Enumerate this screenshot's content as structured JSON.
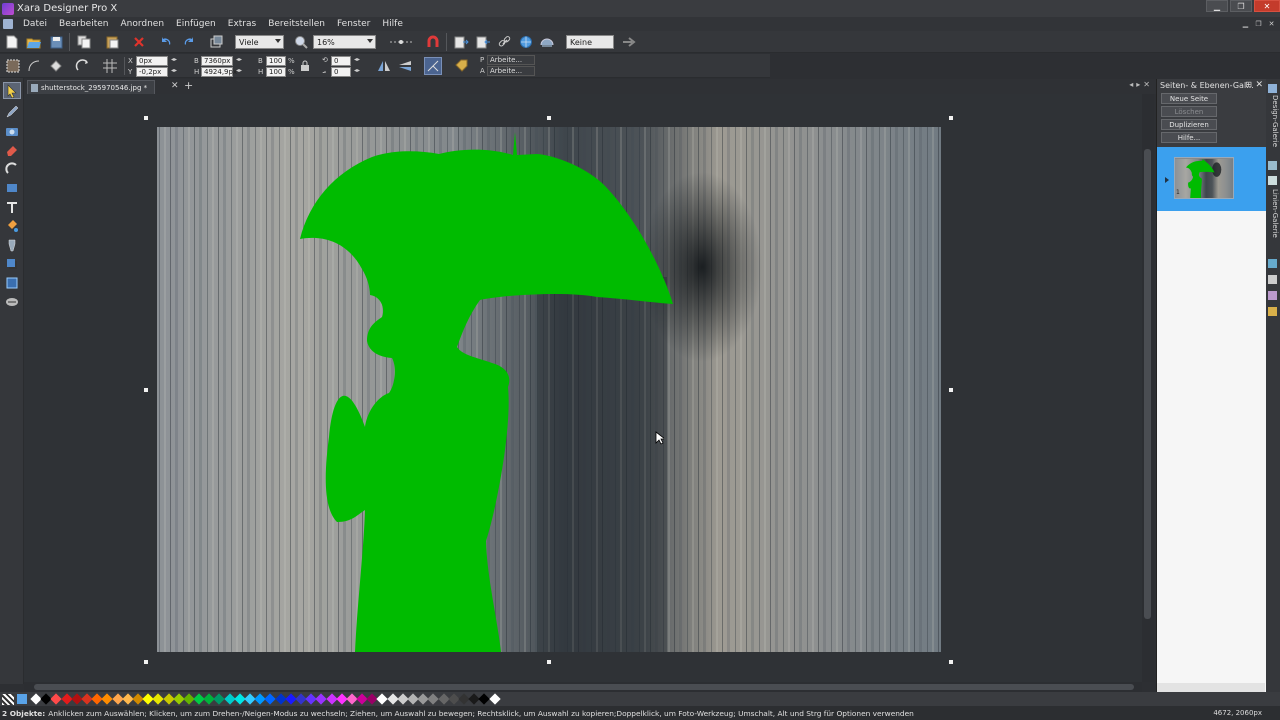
{
  "window": {
    "title": "Xara Designer Pro X"
  },
  "menu": [
    "Datei",
    "Bearbeiten",
    "Anordnen",
    "Einfügen",
    "Extras",
    "Bereitstellen",
    "Fenster",
    "Hilfe"
  ],
  "toolbar1": {
    "quality_combo": "Viele",
    "zoom_combo": "16%",
    "feather_combo": "Keine"
  },
  "toolbar2": {
    "x_label": "X",
    "x_value": "0px",
    "y_label": "Y",
    "y_value": "-0,2px",
    "w_label": "B",
    "w_value": "7360px",
    "h_label": "H",
    "h_value": "4924,9px",
    "sw_label": "B",
    "sw_value": "100",
    "sh_label": "H",
    "sh_value": "100",
    "pct": "%",
    "rotate_value": "0",
    "skew_value": "0",
    "p_label": "P",
    "p_value": "Arbeite...",
    "a_label": "A",
    "a_value": "Arbeite..."
  },
  "document": {
    "tab_label": "shutterstock_295970546.jpg *"
  },
  "panel": {
    "title": "Seiten- & Ebenen-Gal...",
    "buttons": [
      "Neue Seite",
      "Löschen",
      "Duplizieren",
      "Hilfe..."
    ],
    "page_number": "1"
  },
  "side_tabs": [
    "Design-Galerie",
    "Linien-Galerie"
  ],
  "status": {
    "prefix": "2 Objekte:",
    "message": "Anklicken zum Auswählen; Klicken, um zum Drehen-/Neigen-Modus zu wechseln; Ziehen, um Auswahl zu bewegen; Rechtsklick, um Auswahl zu kopieren;Doppelklick, um Foto-Werkzeug; Umschalt, Alt und Strg für Optionen verwenden",
    "coords": "4672, 2060px"
  },
  "palette_colors": [
    "#ffffff",
    "#000000",
    "#ff4a4a",
    "#e31b1b",
    "#b01010",
    "#d9331f",
    "#ff6600",
    "#ff8c00",
    "#ffa64d",
    "#ffb84d",
    "#d18a00",
    "#ffff00",
    "#e6e600",
    "#c9c900",
    "#99cc00",
    "#66b300",
    "#00cc44",
    "#00b33c",
    "#009966",
    "#00cccc",
    "#00e6e6",
    "#33ccff",
    "#0099ff",
    "#0066ff",
    "#0033cc",
    "#1a1aff",
    "#3333cc",
    "#6633ff",
    "#9933ff",
    "#cc33ff",
    "#ff33ff",
    "#ff66cc",
    "#cc0099",
    "#990066",
    "#ffffff",
    "#e6e6e6",
    "#cccccc",
    "#b3b3b3",
    "#999999",
    "#808080",
    "#666666",
    "#4d4d4d",
    "#333333",
    "#1a1a1a",
    "#000000",
    "#ffffff"
  ]
}
